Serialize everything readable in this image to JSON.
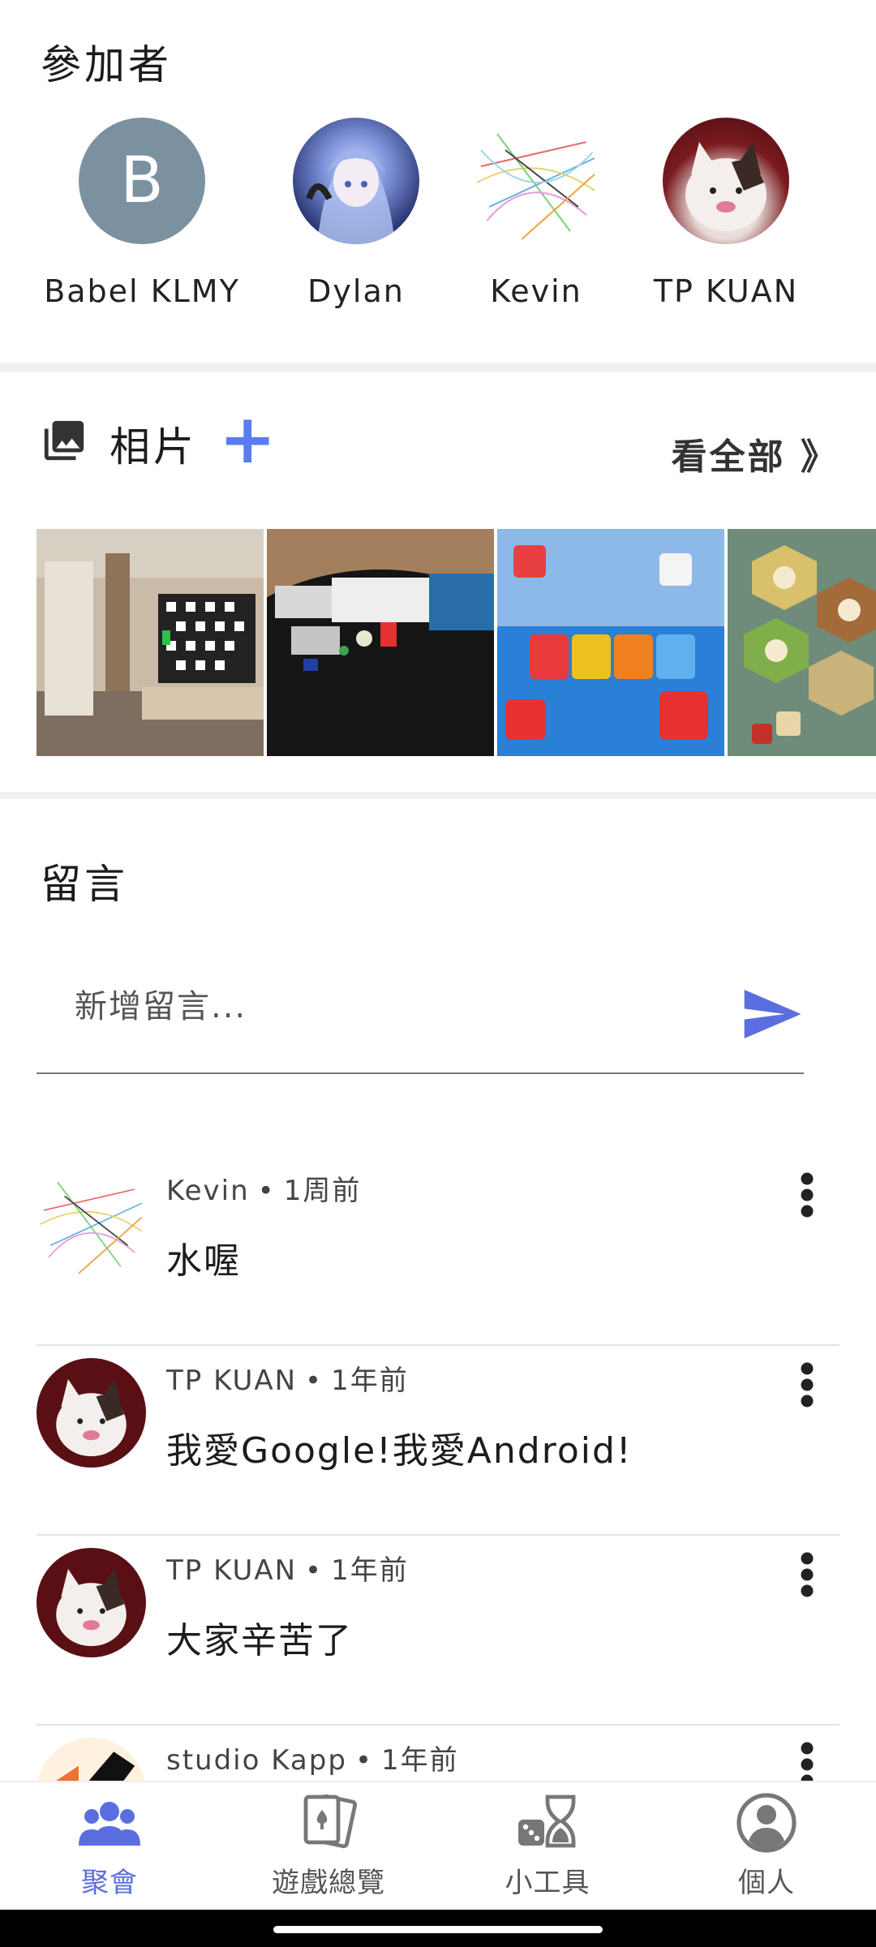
{
  "participants": {
    "title": "參加者",
    "people": [
      {
        "name": "Babel KLMY",
        "avatar_letter": "B"
      },
      {
        "name": "Dylan",
        "avatar_letter": ""
      },
      {
        "name": "Kevin",
        "avatar_letter": ""
      },
      {
        "name": "TP KUAN",
        "avatar_letter": ""
      }
    ]
  },
  "photos": {
    "title": "相片",
    "add_icon": "plus-icon",
    "see_all": "看全部 》",
    "thumbnails": [
      "room-tv",
      "boardgame-table",
      "game-dice",
      "catan-board"
    ]
  },
  "comments": {
    "title": "留言",
    "input_placeholder": "新增留言...",
    "items": [
      {
        "author": "Kevin",
        "time": "1周前",
        "text": "水喔"
      },
      {
        "author": "TP KUAN",
        "time": "1年前",
        "text": "我愛Google!我愛Android!"
      },
      {
        "author": "TP KUAN",
        "time": "1年前",
        "text": "大家辛苦了"
      },
      {
        "author": "studio Kapp",
        "time": "1年前",
        "text": ""
      }
    ]
  },
  "nav": {
    "items": [
      {
        "label": "聚會",
        "icon": "group-icon",
        "active": true
      },
      {
        "label": "遊戲總覽",
        "icon": "cards-icon",
        "active": false
      },
      {
        "label": "小工具",
        "icon": "dice-timer-icon",
        "active": false
      },
      {
        "label": "個人",
        "icon": "profile-icon",
        "active": false
      }
    ]
  },
  "colors": {
    "accent": "#5b6ee0",
    "plus": "#5b7cf0",
    "avatar_letter_bg": "#7b919f"
  }
}
